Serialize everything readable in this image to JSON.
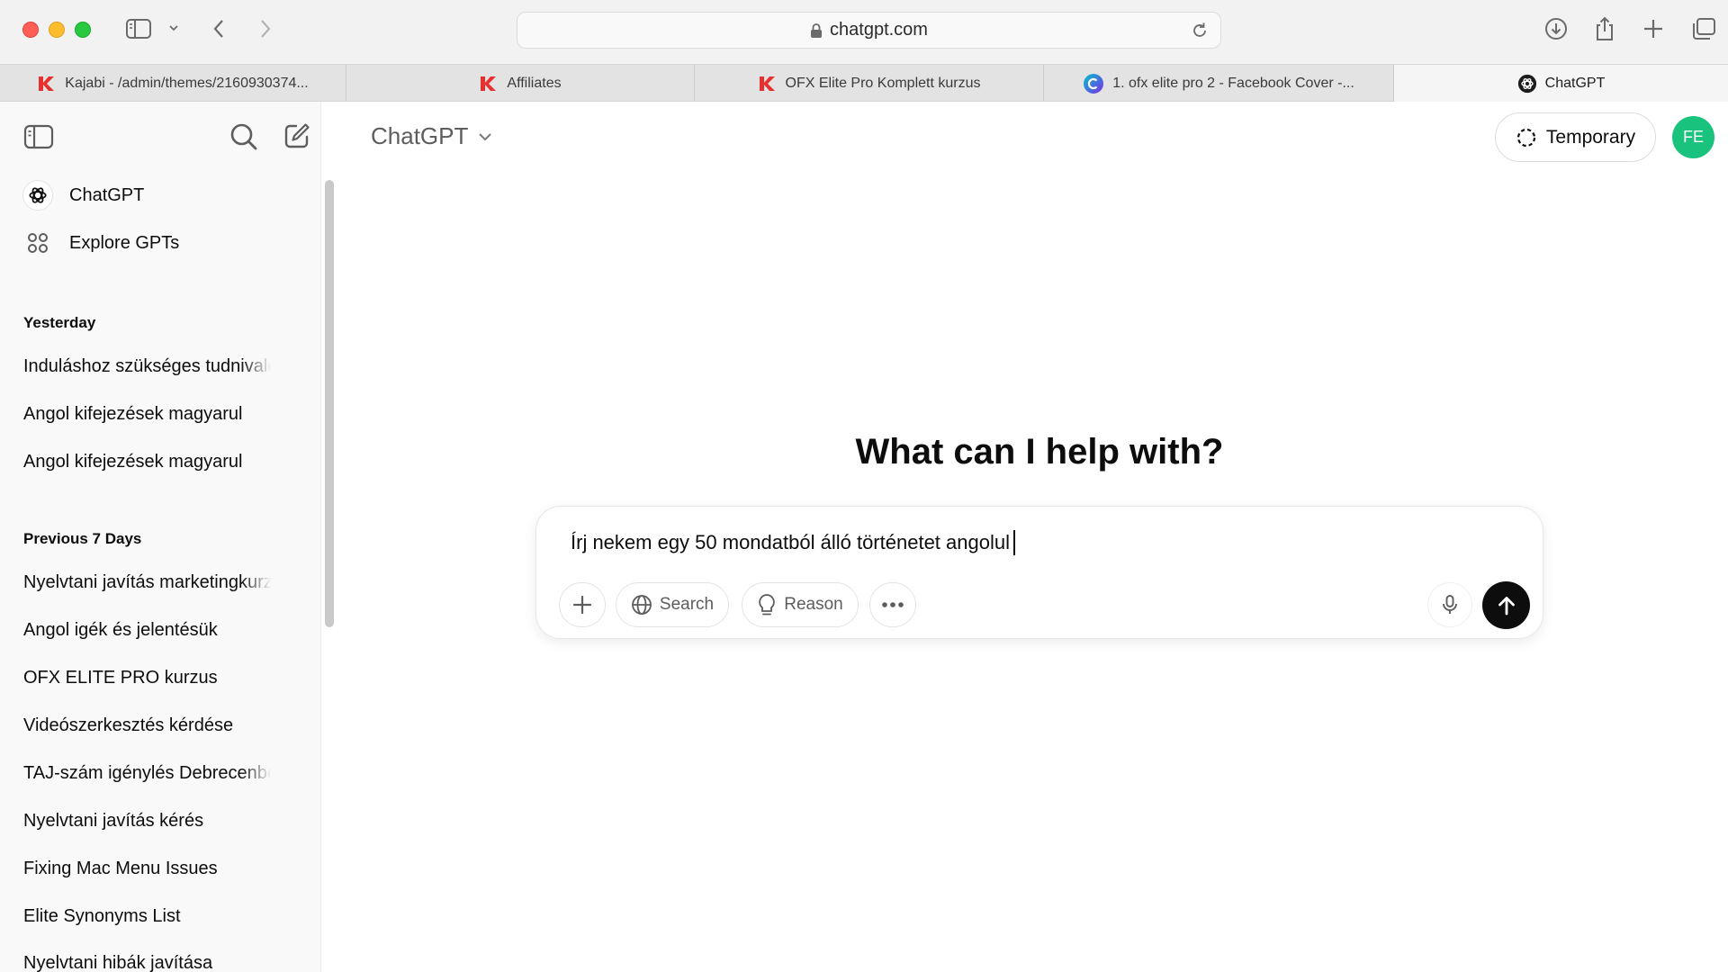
{
  "browser": {
    "url": "chatgpt.com",
    "tabs": [
      {
        "title": "Kajabi - /admin/themes/2160930374...",
        "icon": "kajabi-icon",
        "active": false
      },
      {
        "title": "Affiliates",
        "icon": "kajabi-icon",
        "active": false
      },
      {
        "title": "OFX Elite Pro Komplett kurzus",
        "icon": "kajabi-icon",
        "active": false
      },
      {
        "title": "1. ofx elite pro 2 - Facebook Cover -...",
        "icon": "canva-icon",
        "active": false
      },
      {
        "title": "ChatGPT",
        "icon": "openai-icon",
        "active": true
      }
    ],
    "colors": {
      "kajabi": "#e8312f",
      "canva": "#7d2ae8"
    }
  },
  "sidebar": {
    "top_items": [
      {
        "label": "ChatGPT",
        "icon": "openai-icon"
      },
      {
        "label": "Explore GPTs",
        "icon": "grid-icon"
      }
    ],
    "sections": [
      {
        "title": "Yesterday",
        "items": [
          "Induláshoz szükséges tudnivalók",
          "Angol kifejezések magyarul",
          "Angol kifejezések magyarul"
        ]
      },
      {
        "title": "Previous 7 Days",
        "items": [
          "Nyelvtani javítás marketingkurzus",
          "Angol igék és jelentésük",
          "OFX ELITE PRO kurzus",
          "Videószerkesztés kérdése",
          "TAJ-szám igénylés Debrecenben",
          "Nyelvtani javítás kérés",
          "Fixing Mac Menu Issues",
          "Elite Synonyms List",
          "Nyelvtani hibák javítása"
        ]
      }
    ]
  },
  "main": {
    "model_title": "ChatGPT",
    "temporary_label": "Temporary",
    "avatar_initials": "FE",
    "avatar_color": "#19c37d",
    "headline": "What can I help with?",
    "composer": {
      "text": "Írj nekem egy 50 mondatból álló történetet angolul",
      "buttons": {
        "search": "Search",
        "reason": "Reason"
      }
    }
  }
}
